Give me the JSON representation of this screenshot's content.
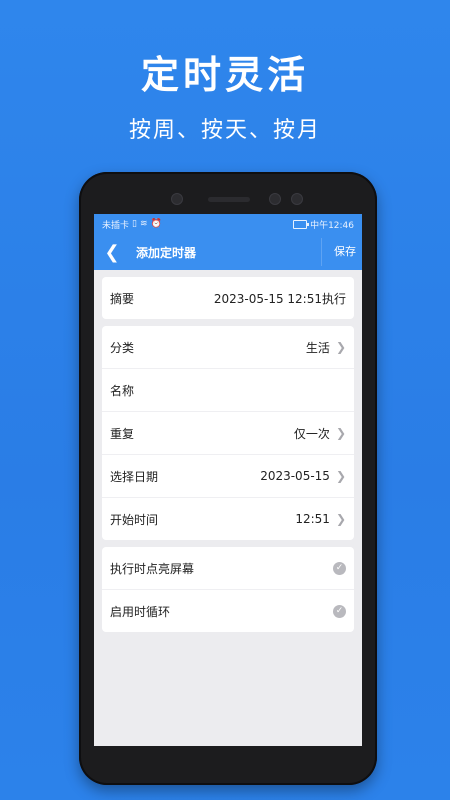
{
  "promo": {
    "headline": "定时灵活",
    "subhead": "按周、按天、按月"
  },
  "status_bar": {
    "left_text": "未插卡",
    "time": "中午12:46"
  },
  "nav": {
    "back_label": "❮",
    "title": "添加定时器",
    "save_label": "保存"
  },
  "summary": {
    "label": "摘要",
    "value": "2023-05-15 12:51执行"
  },
  "form": [
    {
      "label": "分类",
      "value": "生活",
      "chevron": true
    },
    {
      "label": "名称",
      "value": "",
      "chevron": false
    },
    {
      "label": "重复",
      "value": "仅一次",
      "chevron": true
    },
    {
      "label": "选择日期",
      "value": "2023-05-15",
      "chevron": true
    },
    {
      "label": "开始时间",
      "value": "12:51",
      "chevron": true
    }
  ],
  "options": [
    {
      "label": "执行时点亮屏幕"
    },
    {
      "label": "启用时循环"
    }
  ],
  "colors": {
    "background": "#2c82ea",
    "app_bar": "#3a8ff0",
    "chevron": "#a8a8ad",
    "check": "#b9b9be"
  },
  "icons": {
    "back": "chevron-left-icon",
    "chevron": "chevron-right-icon",
    "check": "check-circle-icon"
  }
}
